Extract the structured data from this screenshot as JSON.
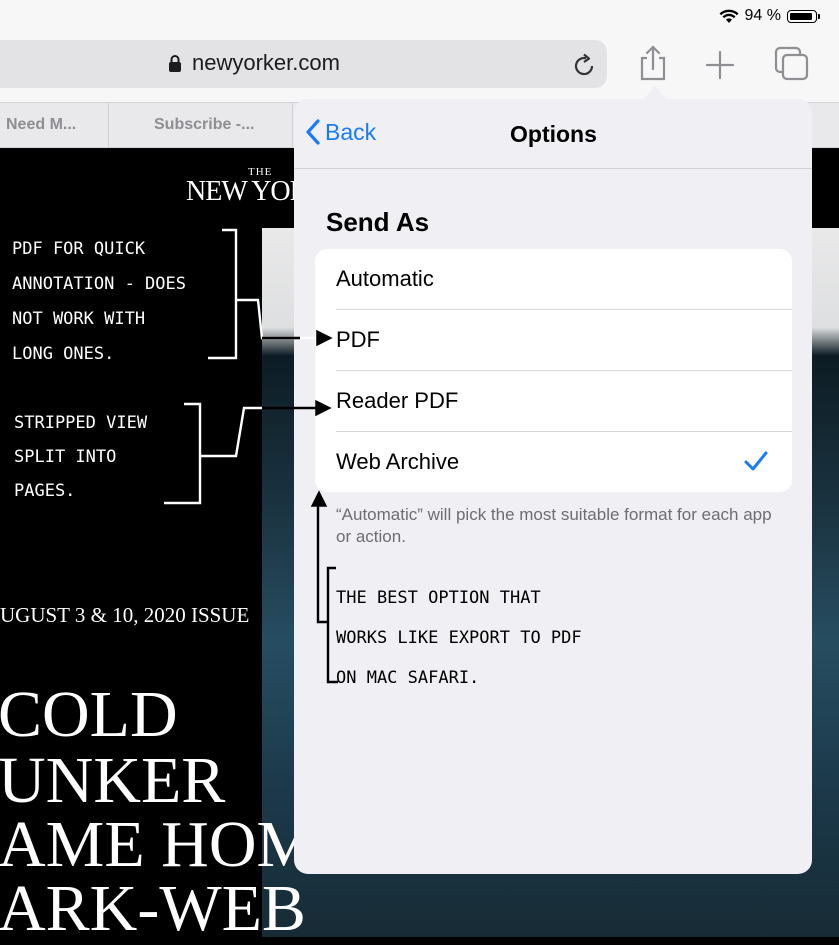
{
  "status_bar": {
    "battery_text": "94 %",
    "battery_level": 0.94
  },
  "toolbar": {
    "url": "newyorker.com"
  },
  "tabs": [
    {
      "label": "Need M..."
    },
    {
      "label": "Subscribe -..."
    }
  ],
  "page": {
    "masthead_the": "THE",
    "masthead": "NEW YORKER",
    "issue": "UGUST 3 & 10, 2020 ISSUE",
    "headline_lines": [
      "COLD",
      "UNKER",
      "AME HOME",
      "ARK-WEB"
    ]
  },
  "popover": {
    "back_label": "Back",
    "title": "Options",
    "section_title": "Send As",
    "options": [
      {
        "label": "Automatic",
        "checked": false
      },
      {
        "label": "PDF",
        "checked": false
      },
      {
        "label": "Reader PDF",
        "checked": false
      },
      {
        "label": "Web Archive",
        "checked": true
      }
    ],
    "footnote": "“Automatic” will pick the most suitable format for each app or action."
  },
  "annotations": {
    "pdf_note": [
      "PDF FOR QUICK",
      "ANNOTATION - DOES",
      "NOT WORK WITH",
      "LONG ONES."
    ],
    "reader_note": [
      "STRIPPED VIEW",
      "SPLIT INTO",
      "PAGES."
    ],
    "archive_note": [
      "THE BEST OPTION THAT",
      "WORKS LIKE EXPORT TO PDF",
      "ON MAC SAFARI."
    ]
  },
  "colors": {
    "accent": "#1a7cf5",
    "popover_bg": "#efeff4",
    "toolbar_bg": "#f7f7f8"
  }
}
